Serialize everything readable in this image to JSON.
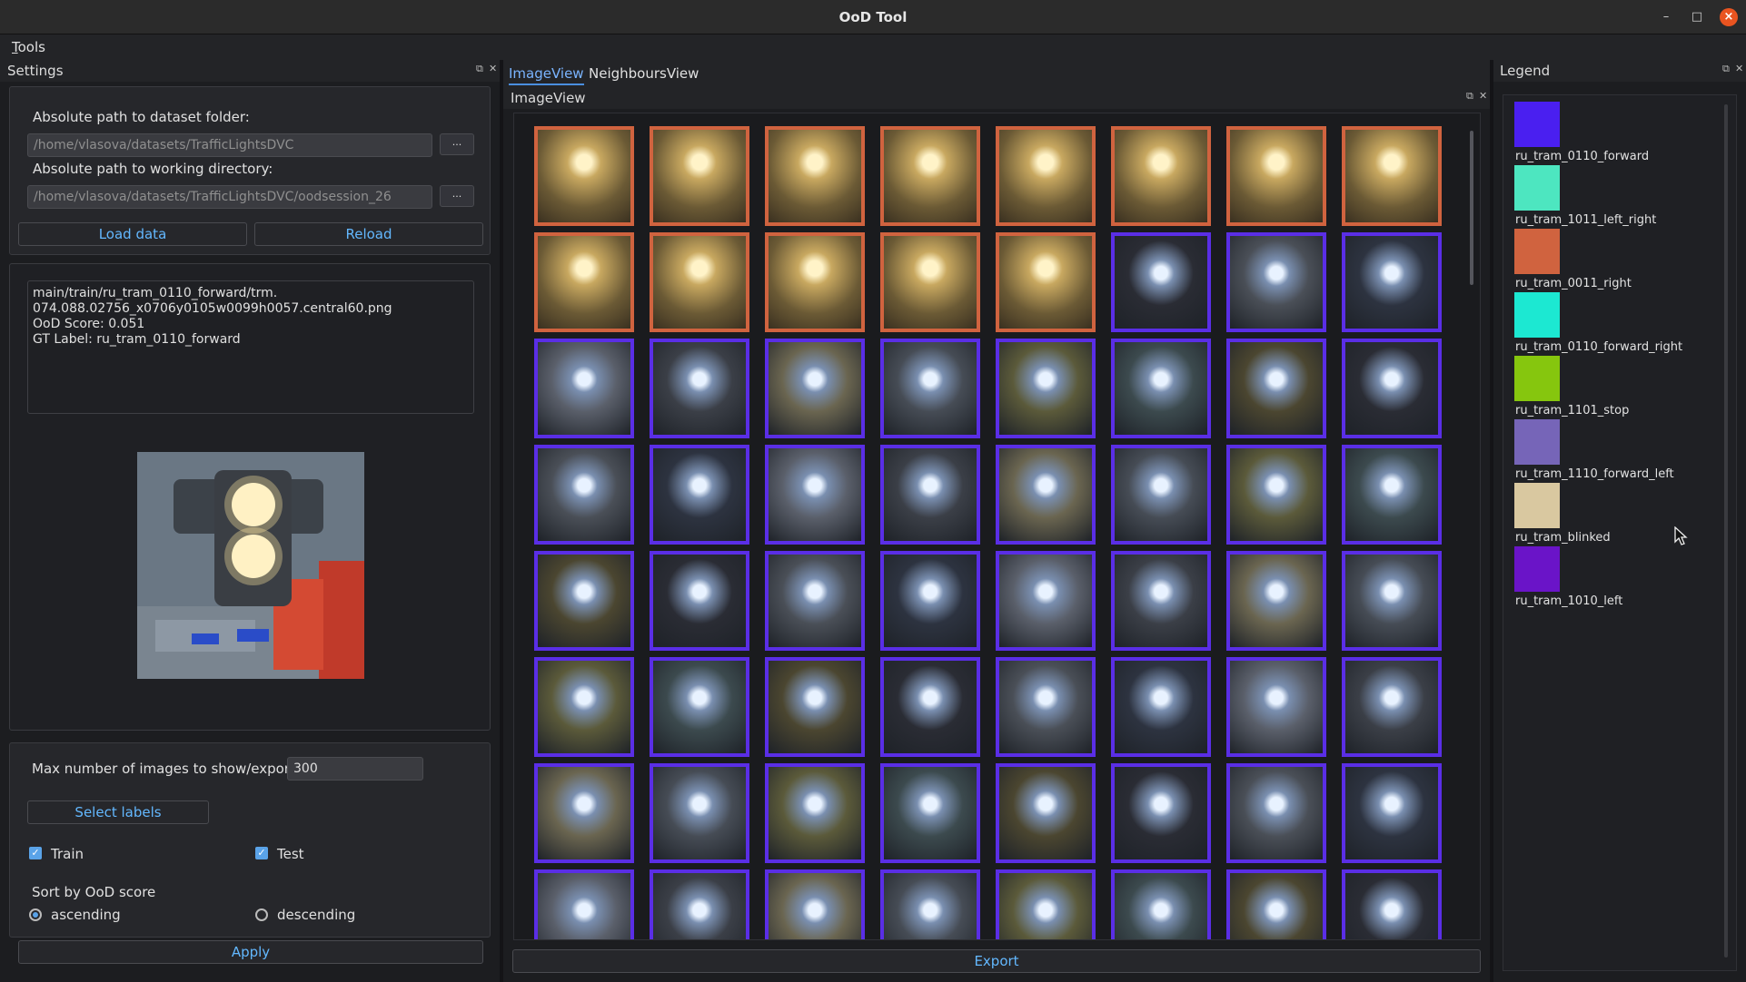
{
  "window": {
    "title": "OoD Tool"
  },
  "menu": {
    "tools": "Tools"
  },
  "settings": {
    "title": "Settings",
    "dataset_label": "Absolute path to dataset folder:",
    "dataset_value": "/home/vlasova/datasets/TrafficLightsDVC",
    "workdir_label": "Absolute path to working directory:",
    "workdir_value": "/home/vlasova/datasets/TrafficLightsDVC/oodsession_26",
    "browse_label": "...",
    "load_button": "Load data",
    "reload_button": "Reload",
    "info_lines": [
      "main/train/ru_tram_0110_forward/trm.",
      "074.088.02756_x0706y0105w0099h0057.central60.png",
      "OoD Score:      0.051",
      "GT Label: ru_tram_0110_forward"
    ],
    "max_images_label": "Max number of images to show/export:",
    "max_images_value": "300",
    "select_labels_button": "Select labels",
    "train_label": "Train",
    "test_label": "Test",
    "sort_label": "Sort by OoD score",
    "ascending_label": "ascending",
    "descending_label": "descending",
    "apply_button": "Apply"
  },
  "center": {
    "tabs": [
      "ImageView",
      "NeighboursView"
    ],
    "dock_title": "ImageView",
    "export_button": "Export",
    "thumb_colors": [
      [
        "#d0633f",
        "#d0633f",
        "#d0633f",
        "#d0633f",
        "#d0633f",
        "#d0633f",
        "#d0633f",
        "#d0633f"
      ],
      [
        "#d0633f",
        "#d0633f",
        "#d0633f",
        "#d0633f",
        "#d0633f",
        "#5a2ee6",
        "#5a2ee6",
        "#5a2ee6"
      ],
      [
        "#5a2ee6",
        "#5a2ee6",
        "#5a2ee6",
        "#5a2ee6",
        "#5a2ee6",
        "#5a2ee6",
        "#5a2ee6",
        "#5a2ee6"
      ],
      [
        "#5a2ee6",
        "#5a2ee6",
        "#5a2ee6",
        "#5a2ee6",
        "#5a2ee6",
        "#5a2ee6",
        "#5a2ee6",
        "#5a2ee6"
      ],
      [
        "#5a2ee6",
        "#5a2ee6",
        "#5a2ee6",
        "#5a2ee6",
        "#5a2ee6",
        "#5a2ee6",
        "#5a2ee6",
        "#5a2ee6"
      ],
      [
        "#5a2ee6",
        "#5a2ee6",
        "#5a2ee6",
        "#5a2ee6",
        "#5a2ee6",
        "#5a2ee6",
        "#5a2ee6",
        "#5a2ee6"
      ],
      [
        "#5a2ee6",
        "#5a2ee6",
        "#5a2ee6",
        "#5a2ee6",
        "#5a2ee6",
        "#5a2ee6",
        "#5a2ee6",
        "#5a2ee6"
      ],
      [
        "#5a2ee6",
        "#5a2ee6",
        "#5a2ee6",
        "#5a2ee6",
        "#5a2ee6",
        "#5a2ee6",
        "#5a2ee6",
        "#5a2ee6"
      ]
    ]
  },
  "legend": {
    "title": "Legend",
    "items": [
      {
        "label": "ru_tram_0110_forward",
        "color": "#4a1ff0"
      },
      {
        "label": "ru_tram_1011_left_right",
        "color": "#4de6c0"
      },
      {
        "label": "ru_tram_0011_right",
        "color": "#d0633f"
      },
      {
        "label": "ru_tram_0110_forward_right",
        "color": "#1ce8d2"
      },
      {
        "label": "ru_tram_1101_stop",
        "color": "#86c60e"
      },
      {
        "label": "ru_tram_1110_forward_left",
        "color": "#7665b8"
      },
      {
        "label": "ru_tram_blinked",
        "color": "#d9c8a0"
      },
      {
        "label": "ru_tram_1010_left",
        "color": "#6a14c8"
      }
    ]
  }
}
